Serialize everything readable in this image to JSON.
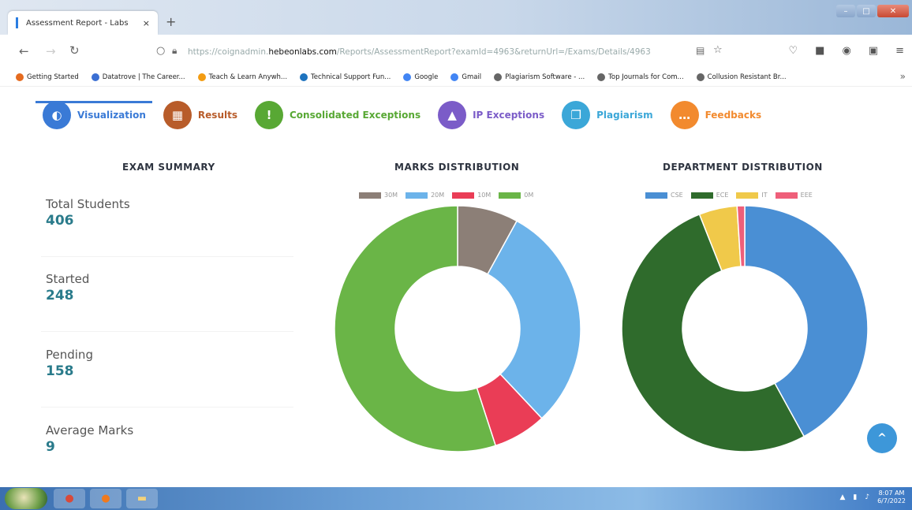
{
  "browser": {
    "tab_title": "Assessment Report - Labs",
    "tab_close": "×",
    "new_tab": "+",
    "url_prefix": "https://coignadmin.",
    "url_host": "hebeonlabs.com",
    "url_path": "/Reports/AssessmentReport?examId=4963&returnUrl=/Exams/Details/4963",
    "bookmarks": [
      {
        "label": "Getting Started",
        "color": "#e56b1f"
      },
      {
        "label": "Datatrove | The Career...",
        "color": "#3b6fd3"
      },
      {
        "label": "Teach & Learn Anywh...",
        "color": "#f39c12"
      },
      {
        "label": "Technical Support Fun...",
        "color": "#1e73be"
      },
      {
        "label": "Google",
        "color": "#4285f4"
      },
      {
        "label": "Gmail",
        "color": "#4285f4"
      },
      {
        "label": "Plagiarism Software - ...",
        "color": "#666666"
      },
      {
        "label": "Top Journals for Com...",
        "color": "#666666"
      },
      {
        "label": "Collusion Resistant Br...",
        "color": "#666666"
      }
    ],
    "bookmarks_more": "»"
  },
  "nav_tabs": [
    {
      "label": "Visualization",
      "icon": "pie-chart-icon",
      "glyph": "◐",
      "color": "#3a7ad6",
      "text_color": "#3a7ad6"
    },
    {
      "label": "Results",
      "icon": "table-icon",
      "glyph": "▦",
      "color": "#b85c2a",
      "text_color": "#b85c2a"
    },
    {
      "label": "Consolidated Exceptions",
      "icon": "exclamation-icon",
      "glyph": "!",
      "color": "#58a834",
      "text_color": "#58a834"
    },
    {
      "label": "IP Exceptions",
      "icon": "warning-icon",
      "glyph": "▲",
      "color": "#7b5cc8",
      "text_color": "#7b5cc8"
    },
    {
      "label": "Plagiarism",
      "icon": "document-icon",
      "glyph": "❐",
      "color": "#3ba7d8",
      "text_color": "#3ba7d8"
    },
    {
      "label": "Feedbacks",
      "icon": "comment-icon",
      "glyph": "…",
      "color": "#f28a2e",
      "text_color": "#f28a2e"
    }
  ],
  "exam_summary": {
    "title": "EXAM SUMMARY",
    "stats": [
      {
        "label": "Total Students",
        "value": "406"
      },
      {
        "label": "Started",
        "value": "248"
      },
      {
        "label": "Pending",
        "value": "158"
      },
      {
        "label": "Average Marks",
        "value": "9"
      }
    ]
  },
  "scroll_top": "^",
  "taskbar": {
    "time": "8:07 AM",
    "date": "6/7/2022"
  },
  "chart_data": [
    {
      "type": "pie",
      "title": "MARKS DISTRIBUTION",
      "donut": true,
      "legend_placement": "top",
      "categories": [
        "30M",
        "20M",
        "10M",
        "0M"
      ],
      "values": [
        8,
        30,
        7,
        55
      ],
      "colors": [
        "#8c7f77",
        "#6cb3ea",
        "#ea3d56",
        "#6ab547"
      ]
    },
    {
      "type": "pie",
      "title": "DEPARTMENT DISTRIBUTION",
      "donut": true,
      "legend_placement": "top",
      "categories": [
        "CSE",
        "ECE",
        "IT",
        "EEE"
      ],
      "values": [
        42,
        52,
        5,
        1
      ],
      "colors": [
        "#4a8fd4",
        "#2f6b2c",
        "#f0c94a",
        "#ef5f7a"
      ]
    }
  ]
}
